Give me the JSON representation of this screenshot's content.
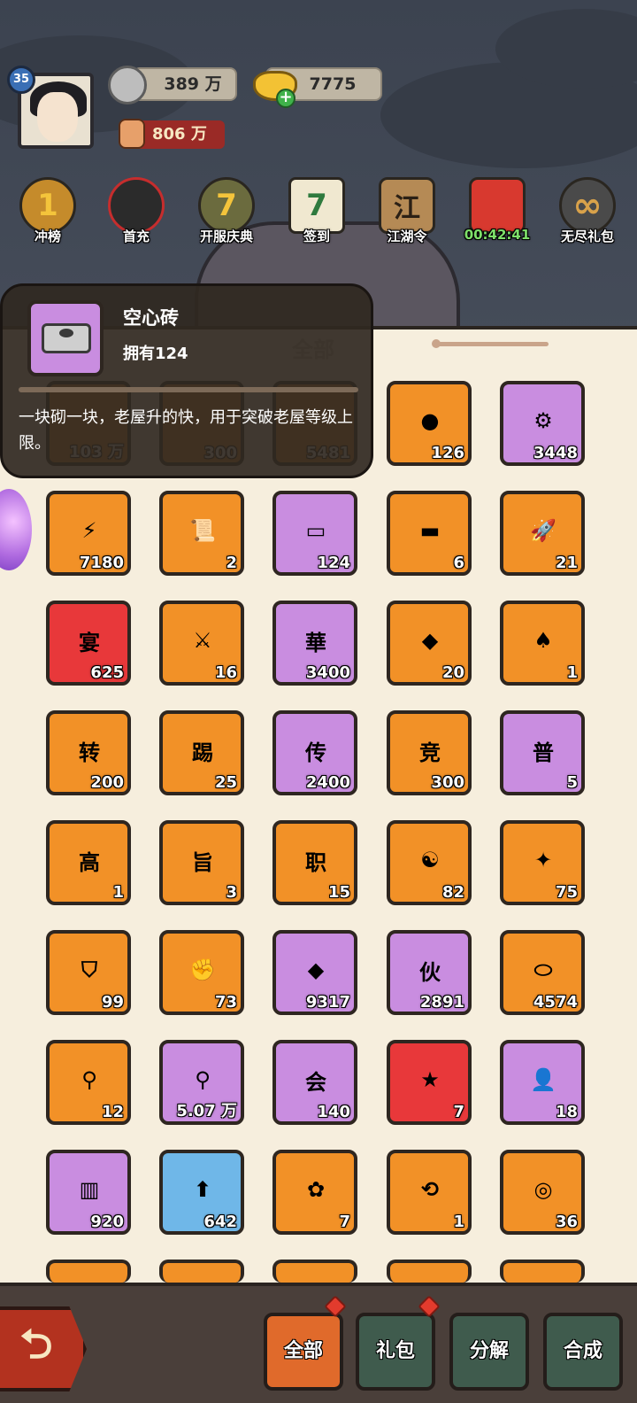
{
  "player": {
    "level": "35",
    "silver": "389 万",
    "gold": "7775",
    "power": "806 万"
  },
  "menu": [
    {
      "label": "冲榜",
      "glyph": "1",
      "icon": "rank-trophy-icon"
    },
    {
      "label": "首充",
      "glyph": "",
      "icon": "first-charge-hero-icon"
    },
    {
      "label": "开服庆典",
      "glyph": "7",
      "icon": "server-celebration-icon"
    },
    {
      "label": "签到",
      "glyph": "7",
      "icon": "calendar-icon"
    },
    {
      "label": "江湖令",
      "glyph": "江",
      "icon": "token-tag-icon"
    },
    {
      "label": "00:42:41",
      "glyph": "",
      "icon": "gift-box-icon"
    },
    {
      "label": "无尽礼包",
      "glyph": "∞",
      "icon": "infinity-icon"
    }
  ],
  "panel": {
    "tab_label": "全部"
  },
  "tooltip": {
    "name": "空心砖",
    "owned": "拥有124",
    "description": "一块砌一块，老屋升的快，用于突破老屋等级上限。"
  },
  "items": [
    {
      "count": "103 万",
      "bg": "orange",
      "icon": "coin-item-icon",
      "glyph": ""
    },
    {
      "count": "300",
      "bg": "orange",
      "icon": "item-icon",
      "glyph": ""
    },
    {
      "count": "5481",
      "bg": "orange",
      "icon": "item-icon",
      "glyph": ""
    },
    {
      "count": "126",
      "bg": "orange",
      "icon": "green-ball-icon",
      "glyph": "●"
    },
    {
      "count": "3448",
      "bg": "purple",
      "icon": "screw-icon",
      "glyph": "⚙"
    },
    {
      "count": "7180",
      "bg": "orange",
      "icon": "energy-can-icon",
      "glyph": "⚡"
    },
    {
      "count": "2",
      "bg": "orange",
      "icon": "scroll-paper-icon",
      "glyph": "📜"
    },
    {
      "count": "124",
      "bg": "purple",
      "icon": "hollow-brick-icon",
      "glyph": "▭"
    },
    {
      "count": "6",
      "bg": "orange",
      "icon": "brick-icon",
      "glyph": "▬"
    },
    {
      "count": "21",
      "bg": "orange",
      "icon": "rocket-icon",
      "glyph": "🚀"
    },
    {
      "count": "625",
      "bg": "red",
      "icon": "banquet-coin-icon",
      "glyph": "宴"
    },
    {
      "count": "16",
      "bg": "orange",
      "icon": "battle-flag-icon",
      "glyph": "⚔"
    },
    {
      "count": "3400",
      "bg": "purple",
      "icon": "green-banner-icon",
      "glyph": "華"
    },
    {
      "count": "20",
      "bg": "orange",
      "icon": "blue-chip-icon",
      "glyph": "◆"
    },
    {
      "count": "1",
      "bg": "orange",
      "icon": "red-chip-icon",
      "glyph": "♠"
    },
    {
      "count": "200",
      "bg": "orange",
      "icon": "transfer-coin-icon",
      "glyph": "转"
    },
    {
      "count": "25",
      "bg": "orange",
      "icon": "kick-badge-icon",
      "glyph": "踢"
    },
    {
      "count": "2400",
      "bg": "purple",
      "icon": "legend-badge-icon",
      "glyph": "传"
    },
    {
      "count": "300",
      "bg": "orange",
      "icon": "compete-coin-icon",
      "glyph": "竞"
    },
    {
      "count": "5",
      "bg": "purple",
      "icon": "common-ticket-icon",
      "glyph": "普"
    },
    {
      "count": "1",
      "bg": "orange",
      "icon": "high-ticket-icon",
      "glyph": "高"
    },
    {
      "count": "3",
      "bg": "orange",
      "icon": "banner-card-icon",
      "glyph": "旨"
    },
    {
      "count": "15",
      "bg": "orange",
      "icon": "job-badge-icon",
      "glyph": "职"
    },
    {
      "count": "82",
      "bg": "orange",
      "icon": "taiji-pouch-icon",
      "glyph": "☯"
    },
    {
      "count": "75",
      "bg": "orange",
      "icon": "gun-pouch-icon",
      "glyph": "✦"
    },
    {
      "count": "99",
      "bg": "orange",
      "icon": "shield-pouch-icon",
      "glyph": "⛉"
    },
    {
      "count": "73",
      "bg": "orange",
      "icon": "fist-pouch-icon",
      "glyph": "✊"
    },
    {
      "count": "9317",
      "bg": "purple",
      "icon": "stone-icon",
      "glyph": "◆"
    },
    {
      "count": "2891",
      "bg": "purple",
      "icon": "partner-card-icon",
      "glyph": "伙"
    },
    {
      "count": "4574",
      "bg": "orange",
      "icon": "log-roll-icon",
      "glyph": "⬭"
    },
    {
      "count": "12",
      "bg": "orange",
      "icon": "spatula-card-icon",
      "glyph": "⚲"
    },
    {
      "count": "5.07 万",
      "bg": "purple",
      "icon": "spatula-badge-icon",
      "glyph": "⚲"
    },
    {
      "count": "140",
      "bg": "purple",
      "icon": "guild-coin-icon",
      "glyph": "会"
    },
    {
      "count": "7",
      "bg": "red",
      "icon": "star-medal-icon",
      "glyph": "★"
    },
    {
      "count": "18",
      "bg": "purple",
      "icon": "person-card-icon",
      "glyph": "👤"
    },
    {
      "count": "920",
      "bg": "purple",
      "icon": "wood-plank-icon",
      "glyph": "▥"
    },
    {
      "count": "642",
      "bg": "blue",
      "icon": "upgrade-hammer-icon",
      "glyph": "⬆"
    },
    {
      "count": "7",
      "bg": "orange",
      "icon": "flower-hammer-icon",
      "glyph": "✿"
    },
    {
      "count": "1",
      "bg": "orange",
      "icon": "refresh-hammer-icon",
      "glyph": "⟲"
    },
    {
      "count": "36",
      "bg": "orange",
      "icon": "rope-spool-icon",
      "glyph": "◎"
    }
  ],
  "bottom": {
    "tabs": [
      "全部",
      "礼包",
      "分解",
      "合成"
    ]
  }
}
